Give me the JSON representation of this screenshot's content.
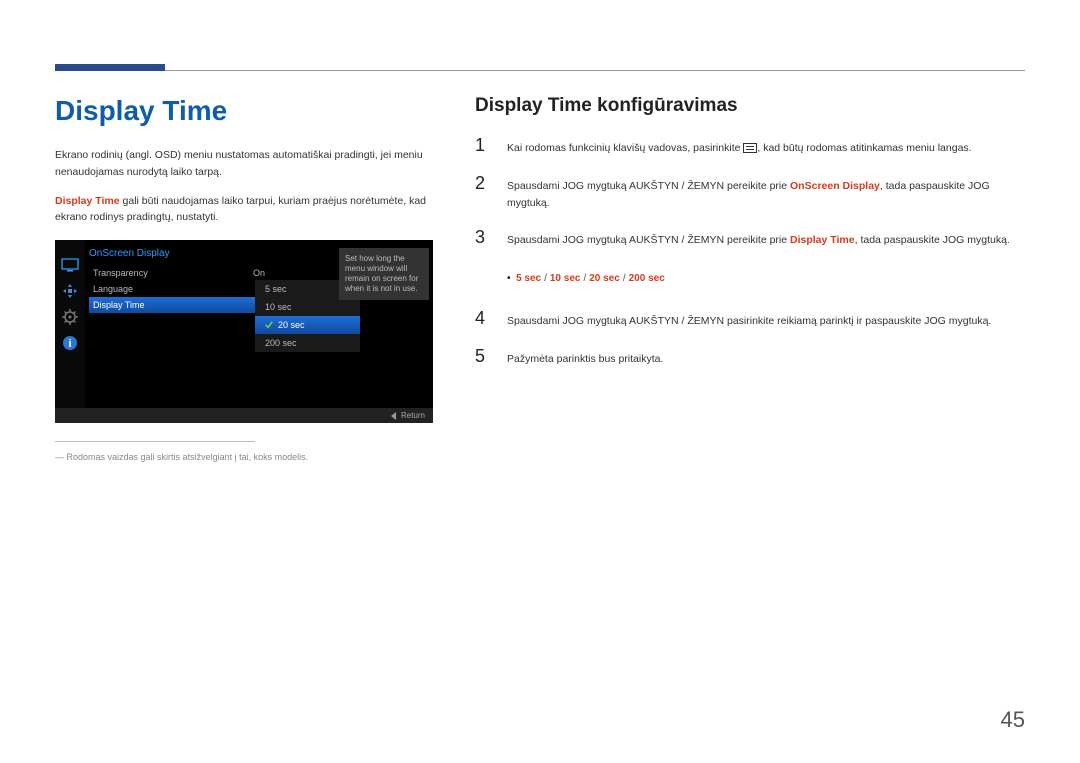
{
  "left": {
    "heading": "Display Time",
    "para1": "Ekrano rodinių (angl. OSD) meniu nustatomas automatiškai pradingti, jei meniu nenaudojamas nurodytą laiko tarpą.",
    "para2_bold": "Display Time",
    "para2_rest": " gali būti naudojamas laiko tarpui, kuriam praėjus norėtumėte, kad ekrano rodinys pradingtų, nustatyti.",
    "footnote": "Rodomas vaizdas gali skirtis atsižvelgiant į tai, koks modelis."
  },
  "osd": {
    "title": "OnScreen Display",
    "row1_label": "Transparency",
    "row1_val": "On",
    "row2_label": "Language",
    "row3_label": "Display Time",
    "opt1": "5 sec",
    "opt2": "10 sec",
    "opt3": "20 sec",
    "opt4": "200 sec",
    "tip": "Set how long the menu window will remain on screen for when it is not in use.",
    "return": "Return"
  },
  "right": {
    "heading": "Display Time konfigūravimas",
    "step1_a": "Kai rodomas funkcinių klavišų vadovas, pasirinkite ",
    "step1_b": ", kad būtų rodomas atitinkamas meniu langas.",
    "step2_a": "Spausdami JOG mygtuką AUKŠTYN / ŽEMYN pereikite prie ",
    "step2_bold": "OnScreen Display",
    "step2_b": ", tada paspauskite JOG mygtuką.",
    "step3_a": "Spausdami JOG mygtuką AUKŠTYN / ŽEMYN pereikite prie ",
    "step3_bold": "Display Time",
    "step3_b": ", tada paspauskite JOG mygtuką.",
    "opts": {
      "o1": "5 sec",
      "o2": "10 sec",
      "o3": "20 sec",
      "o4": "200 sec"
    },
    "step4": "Spausdami JOG mygtuką AUKŠTYN / ŽEMYN pasirinkite reikiamą parinktį ir paspauskite JOG mygtuką.",
    "step5": "Pažymėta parinktis bus pritaikyta."
  },
  "page": "45"
}
